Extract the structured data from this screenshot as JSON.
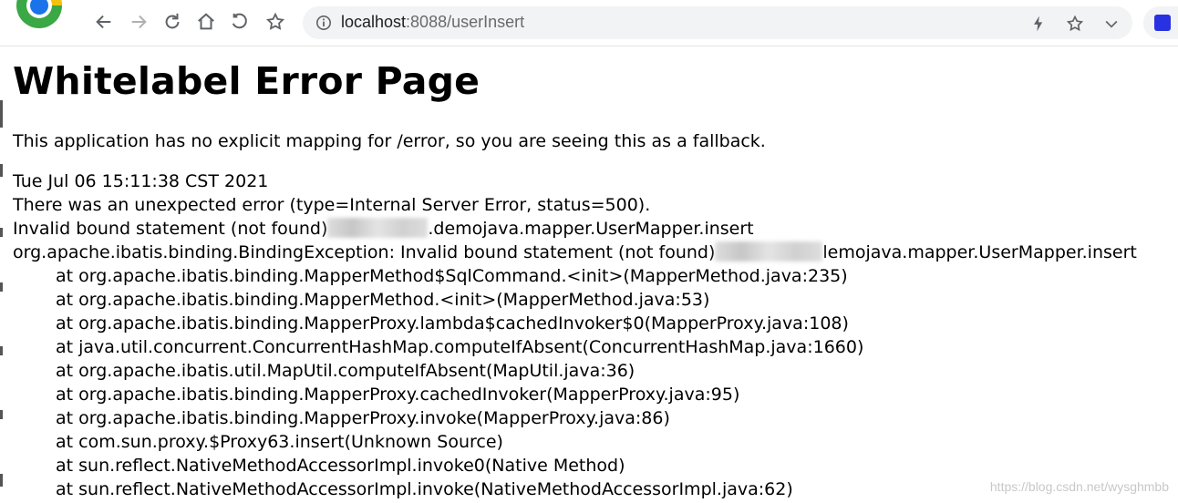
{
  "browser": {
    "url_host": "localhost",
    "url_path": ":8088/userInsert"
  },
  "page": {
    "title": "Whitelabel Error Page",
    "lead": "This application has no explicit mapping for /error, so you are seeing this as a fallback.",
    "timestamp": "Tue Jul 06 15:11:38 CST 2021",
    "error_line": "There was an unexpected error (type=Internal Server Error, status=500).",
    "invalid_prefix": "Invalid bound statement (not found)",
    "invalid_suffix": ".demojava.mapper.UserMapper.insert",
    "exception_prefix": "org.apache.ibatis.binding.BindingException: Invalid bound statement (not found)",
    "exception_suffix": "lemojava.mapper.UserMapper.insert",
    "stack_trace": [
      "at org.apache.ibatis.binding.MapperMethod$SqlCommand.<init>(MapperMethod.java:235)",
      "at org.apache.ibatis.binding.MapperMethod.<init>(MapperMethod.java:53)",
      "at org.apache.ibatis.binding.MapperProxy.lambda$cachedInvoker$0(MapperProxy.java:108)",
      "at java.util.concurrent.ConcurrentHashMap.computeIfAbsent(ConcurrentHashMap.java:1660)",
      "at org.apache.ibatis.util.MapUtil.computeIfAbsent(MapUtil.java:36)",
      "at org.apache.ibatis.binding.MapperProxy.cachedInvoker(MapperProxy.java:95)",
      "at org.apache.ibatis.binding.MapperProxy.invoke(MapperProxy.java:86)",
      "at com.sun.proxy.$Proxy63.insert(Unknown Source)",
      "at sun.reflect.NativeMethodAccessorImpl.invoke0(Native Method)",
      "at sun.reflect.NativeMethodAccessorImpl.invoke(NativeMethodAccessorImpl.java:62)"
    ]
  },
  "watermark": "https://blog.csdn.net/wysghmbb",
  "icons": {
    "back": "back-arrow-icon",
    "forward": "forward-arrow-icon",
    "reload": "reload-icon",
    "home": "home-icon",
    "undo": "undo-icon",
    "bookmark": "star-icon",
    "info": "info-icon",
    "lightning": "lightning-icon",
    "favorite": "star-icon",
    "dropdown": "chevron-down-icon",
    "extension": "baidu-paw-icon"
  },
  "colors": {
    "toolbar_bg": "#ffffff",
    "address_bg": "#f1f3f4",
    "text": "#000000",
    "watermark": "#c8c8c8"
  }
}
